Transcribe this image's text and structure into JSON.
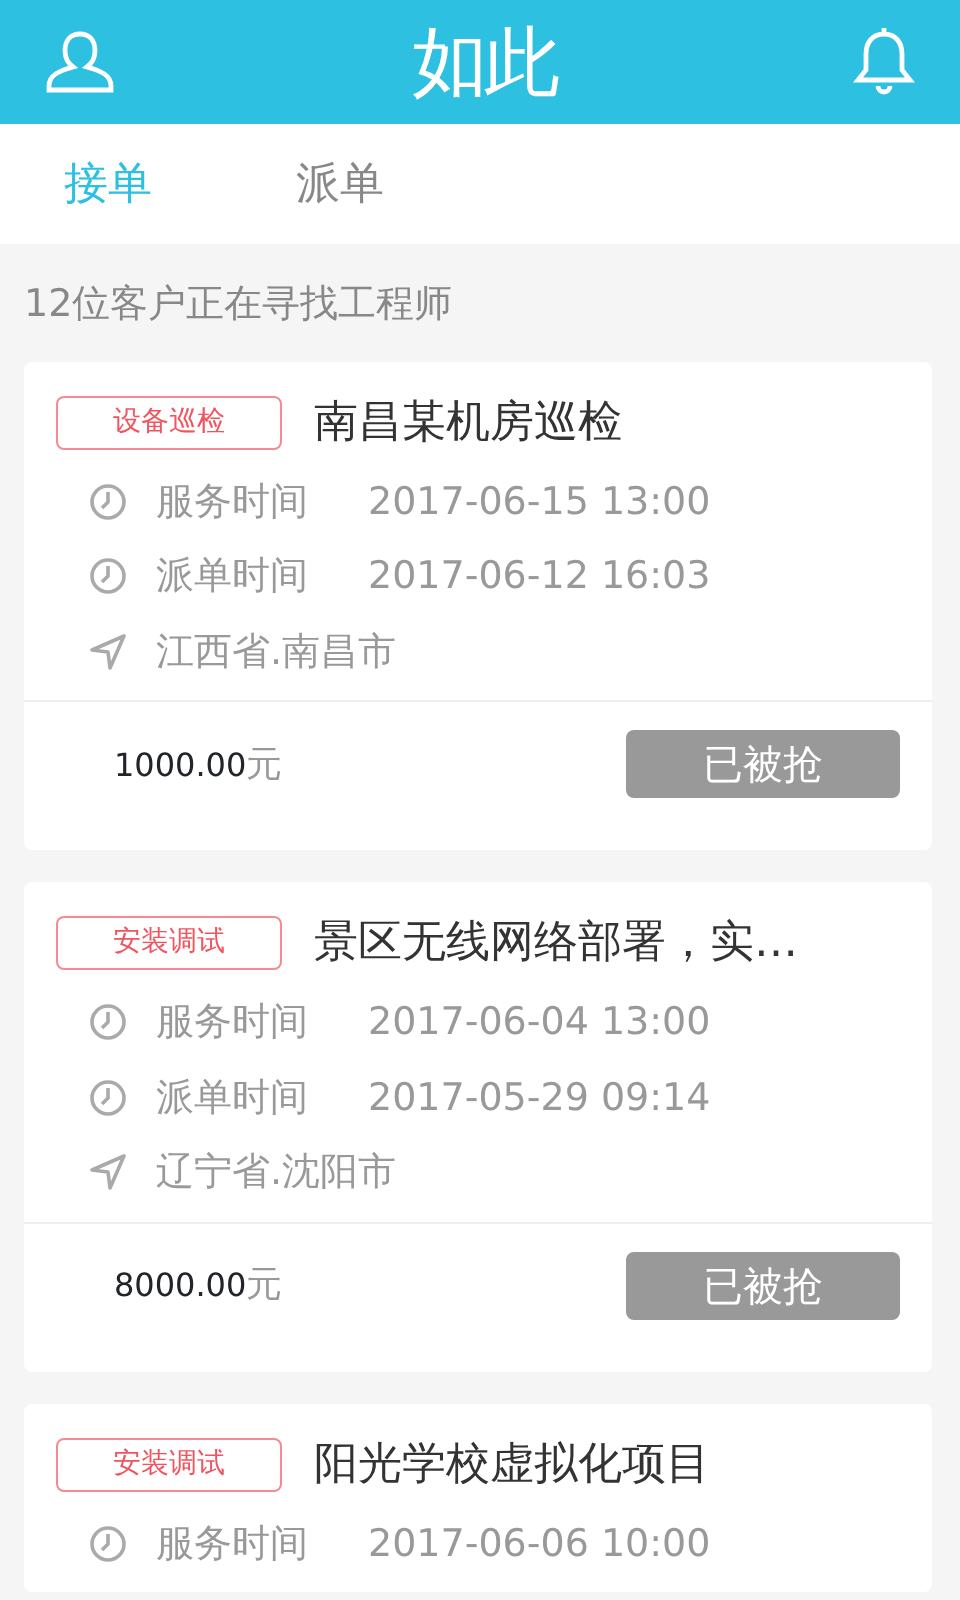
{
  "header": {
    "logo": "如此"
  },
  "tabs": [
    {
      "label": "接单",
      "selected": true
    },
    {
      "label": "派单",
      "selected": false
    }
  ],
  "summary": "12位客户正在寻找工程师",
  "orders": [
    {
      "tag": "设备巡检",
      "title": "南昌某机房巡检",
      "rows": [
        {
          "kind": "time",
          "label": "服务时间",
          "value": "2017-06-15 13:00"
        },
        {
          "kind": "time",
          "label": "派单时间",
          "value": "2017-06-12 16:03"
        },
        {
          "kind": "location",
          "value": "江西省.南昌市"
        }
      ],
      "price": "1000.00",
      "unit": "元",
      "action": {
        "label": "已被抢",
        "disabled": true
      }
    },
    {
      "tag": "安装调试",
      "title": "景区无线网络部署，实…",
      "rows": [
        {
          "kind": "time",
          "label": "服务时间",
          "value": "2017-06-04 13:00"
        },
        {
          "kind": "time",
          "label": "派单时间",
          "value": "2017-05-29 09:14"
        },
        {
          "kind": "location",
          "value": "辽宁省.沈阳市"
        }
      ],
      "price": "8000.00",
      "unit": "元",
      "action": {
        "label": "已被抢",
        "disabled": true
      }
    },
    {
      "tag": "安装调试",
      "title": "阳光学校虚拟化项目",
      "rows": [
        {
          "kind": "time",
          "label": "服务时间",
          "value": "2017-06-06 10:00"
        }
      ]
    }
  ]
}
